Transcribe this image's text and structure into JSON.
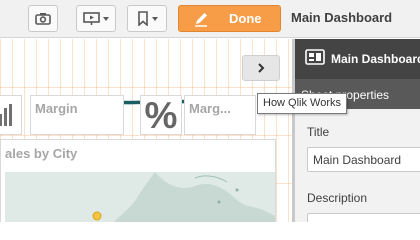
{
  "toolbar": {
    "done_label": "Done",
    "app_title": "Main Dashboard"
  },
  "canvas": {
    "kpis": [
      {
        "label": "Margin"
      },
      {
        "label": "Marg..."
      }
    ],
    "percent_symbol": "%",
    "map_title": "ales by City"
  },
  "tooltip": "How Qlik Works",
  "properties": {
    "header_title": "Main Dashboard",
    "section_title": "Sheet properties",
    "title_label": "Title",
    "title_value": "Main Dashboard",
    "description_label": "Description"
  },
  "colors": {
    "accent": "#f89d47",
    "arrow": "#1d5e63",
    "panel_dark": "#444444"
  }
}
